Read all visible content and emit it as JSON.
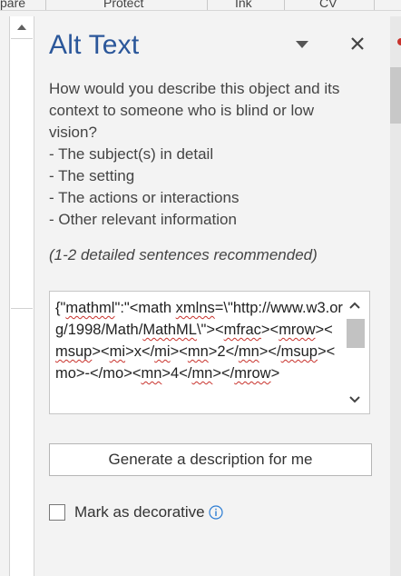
{
  "ribbon": {
    "groups": [
      "pare",
      "Protect",
      "Ink",
      "CV"
    ]
  },
  "pane": {
    "title": "Alt Text",
    "instructions": [
      "How would you describe this object and its",
      "context to someone who is blind or low",
      "vision?",
      "- The subject(s) in detail",
      "- The setting",
      "- The actions or interactions",
      "- Other relevant information"
    ],
    "recommendation": "(1-2 detailed sentences recommended)",
    "alt_text_value": "{\"mathml\":\"<math xmlns=\\\"http://www.w3.org/1998/Math/MathML\\\"><mfrac><mrow><msup><mi>x</mi><mn>2</mn></msup><mo>-</mo><mn>4</mn></mrow>",
    "generate_button": "Generate a description for me",
    "decorative_label": "Mark as decorative",
    "decorative_checked": false
  },
  "icons": {
    "options": "chevron-down-icon",
    "close": "close-icon",
    "info": "info-icon",
    "scroll_up": "scroll-up-icon",
    "scroll_down": "scroll-down-icon"
  },
  "colors": {
    "title": "#2b579a",
    "pane_bg": "#f3f3f3",
    "info": "#2b7cd3"
  }
}
